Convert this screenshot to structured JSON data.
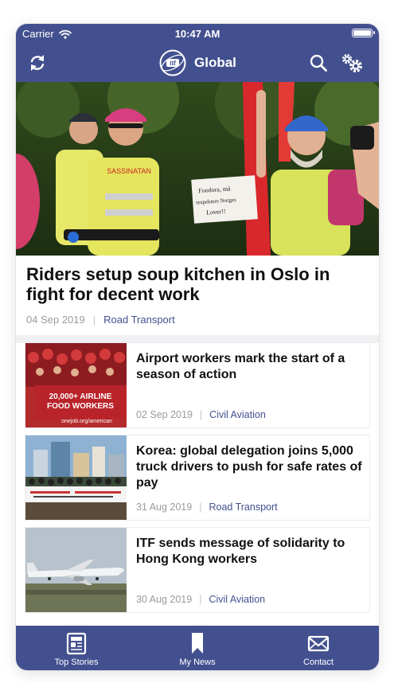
{
  "status_bar": {
    "carrier": "Carrier",
    "time": "10:47 AM"
  },
  "nav": {
    "title": "Global",
    "icons": [
      "refresh-icon",
      "itf-logo",
      "search-icon",
      "settings-icon"
    ]
  },
  "hero": {
    "title": "Riders setup soup kitchen in Oslo in fight for decent work",
    "date": "04 Sep 2019",
    "category": "Road Transport",
    "image_signs": {
      "sign_left": "SASSINATAN",
      "sign_right_1": "Foodora, må",
      "sign_right_2": "respektere Norges",
      "sign_right_3": "Lover!!"
    }
  },
  "articles": [
    {
      "title": "Airport workers mark the start of a season of action",
      "date": "02 Sep 2019",
      "category": "Civil Aviation",
      "image_text_1": "20,000+ AIRLINE",
      "image_text_2": "FOOD WORKERS",
      "image_text_3": "onejob.org/american"
    },
    {
      "title": "Korea: global delegation joins 5,000 truck drivers to push for safe rates of pay",
      "date": "31 Aug 2019",
      "category": "Road Transport"
    },
    {
      "title": "ITF sends message of solidarity to Hong Kong workers",
      "date": "30 Aug 2019",
      "category": "Civil Aviation"
    }
  ],
  "tabs": [
    {
      "label": "Top Stories",
      "icon": "newspaper-icon"
    },
    {
      "label": "My News",
      "icon": "bookmark-icon"
    },
    {
      "label": "Contact",
      "icon": "envelope-icon"
    }
  ],
  "colors": {
    "brand": "#43508f",
    "category": "#43508f",
    "meta_text": "#9a9aa0"
  }
}
